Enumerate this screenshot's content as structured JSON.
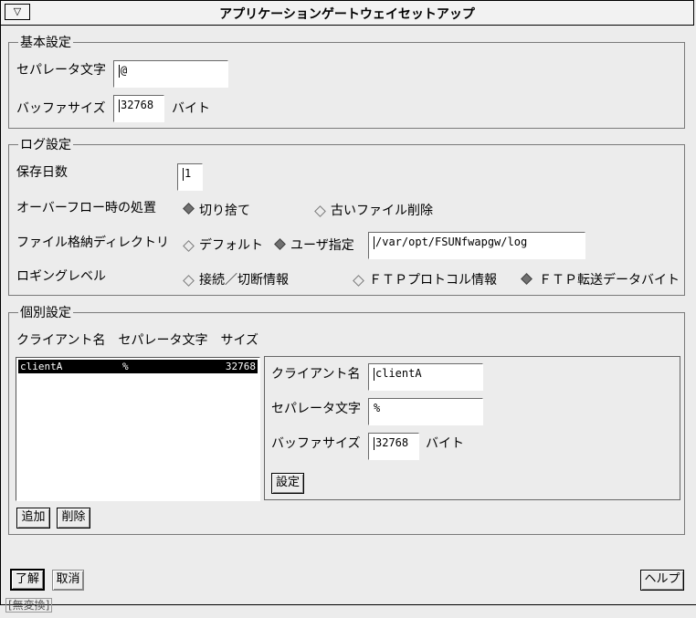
{
  "window": {
    "title": "アプリケーションゲートウェイセットアップ",
    "sysmenu": "▽"
  },
  "basic": {
    "legend": "基本設定",
    "separator_label": "セパレータ文字",
    "separator_value": "@",
    "buffer_label": "バッファサイズ",
    "buffer_value": "32768",
    "buffer_unit": "バイト"
  },
  "log": {
    "legend": "ログ設定",
    "days_label": "保存日数",
    "days_value": "1",
    "overflow_label": "オーバーフロー時の処置",
    "overflow_opt1": "切り捨て",
    "overflow_opt2": "古いファイル削除",
    "dir_label": "ファイル格納ディレクトリ",
    "dir_opt1": "デフォルト",
    "dir_opt2": "ユーザ指定",
    "dir_value": "/var/opt/FSUNfwapgw/log",
    "level_label": "ロギングレベル",
    "level_opt1": "接続／切断情報",
    "level_opt2": "ＦＴＰプロトコル情報",
    "level_opt3": "ＦＴＰ転送データバイト"
  },
  "individual": {
    "legend": "個別設定",
    "list_header": "クライアント名　セパレータ文字　サイズ",
    "rows": [
      {
        "client": "clientA",
        "sep": "%",
        "size": "32768"
      }
    ],
    "client_label": "クライアント名",
    "client_value": "clientA",
    "sep_label": "セパレータ文字",
    "sep_value": "%",
    "buf_label": "バッファサイズ",
    "buf_value": "32768",
    "buf_unit": "バイト",
    "set_button": "設定",
    "add_button": "追加",
    "delete_button": "削除"
  },
  "footer": {
    "ok_button": "了解",
    "cancel_button": "取消",
    "help_button": "ヘルプ",
    "status": "[無変換]"
  }
}
